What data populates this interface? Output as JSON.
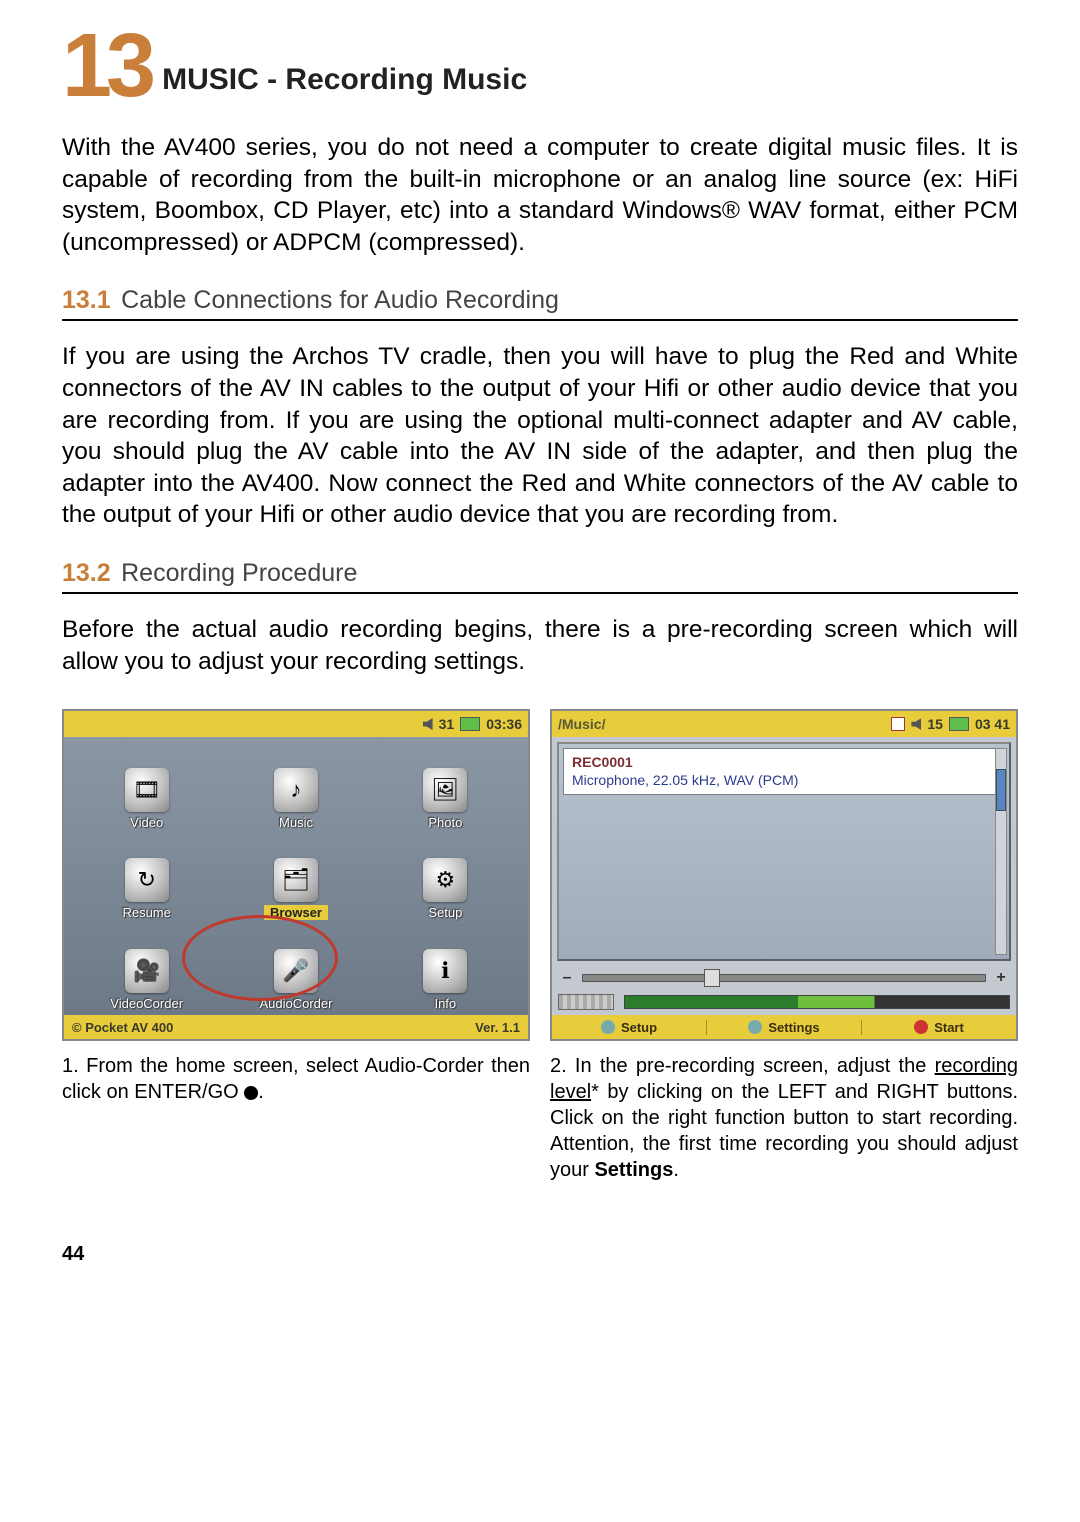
{
  "chapter": {
    "number": "13",
    "title": "MUSIC - Recording Music"
  },
  "intro": "With the AV400 series, you do not need a computer to create digital music files. It is capable of recording from the built-in microphone or an analog line source (ex: HiFi system, Boombox, CD Player, etc) into a standard Windows® WAV format, either PCM (uncompressed) or ADPCM (compressed).",
  "sections": {
    "s1": {
      "number": "13.1",
      "title": "Cable Connections for Audio Recording",
      "body": "If you are using the Archos TV cradle, then you will have to plug the Red and White connectors of the AV IN cables to the output of your Hifi or other audio device that you are recording from. If you are using the optional multi-connect adapter and AV cable, you should plug the AV cable into the AV IN side of the adapter, and then plug the adapter into the AV400. Now connect the Red and White connectors of the AV cable to the output of your Hifi or other audio device that you are recording from."
    },
    "s2": {
      "number": "13.2",
      "title": "Recording Procedure",
      "body": "Before the actual audio recording begins, there is a pre-recording screen which will allow you to adjust your recording settings."
    }
  },
  "screenshot1": {
    "status": {
      "battery": "31",
      "clock": "03:36"
    },
    "grid": {
      "r0c0": "Video",
      "r0c1": "Music",
      "r0c2": "Photo",
      "r1c0": "Resume",
      "r1c1": "Browser",
      "r1c2": "Setup",
      "r2c0": "VideoCorder",
      "r2c1": "AudioCorder",
      "r2c2": "Info"
    },
    "footer": {
      "left": "© Pocket AV 400",
      "right": "Ver. 1.1"
    }
  },
  "screenshot2": {
    "titlebar": {
      "path": "/Music/",
      "battery": "15",
      "clock": "03 41"
    },
    "recording": {
      "name": "REC0001",
      "details": "Microphone, 22.05 kHz, WAV (PCM)"
    },
    "softkeys": {
      "k1": "Setup",
      "k2": "Settings",
      "k3": "Start"
    }
  },
  "captions": {
    "c1a": "1. From the home screen, select Audio-Corder then click on ENTER/GO ",
    "c1b": ".",
    "c2a": "2. In the pre-recording screen, adjust the ",
    "c2_underlined": "recording level",
    "c2b": "* by clicking on the LEFT and RIGHT buttons. Click on the right function button to start recording. Attention, the first time recording you should adjust your ",
    "c2_bold": "Settings",
    "c2c": "."
  },
  "page_number": "44"
}
